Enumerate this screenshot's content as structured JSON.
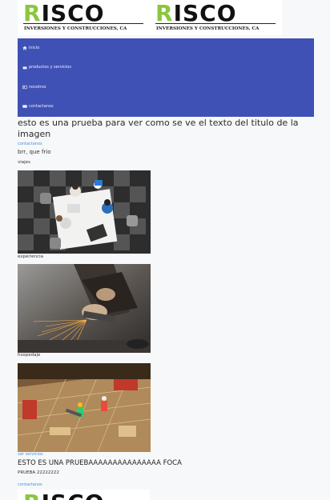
{
  "header": {
    "logo_text_r": "R",
    "logo_text_rest": "ISCO",
    "logo_tagline": "INVERSIONES Y CONSTRUCCIONES, CA"
  },
  "nav": {
    "items": [
      {
        "label": "inicio",
        "icon": "home-icon"
      },
      {
        "label": "productos y servicios",
        "icon": "calendar-icon"
      },
      {
        "label": "nosotros",
        "icon": "card-icon"
      },
      {
        "label": "contactanos",
        "icon": "mail-icon"
      }
    ]
  },
  "main": {
    "title": "esto es una prueba para ver como se ve el texto del titulo de la imagen",
    "contact_link": "contactanos",
    "subtitle": "brr, que frio",
    "sections": [
      {
        "label": "viajes",
        "image": "meeting-photo"
      },
      {
        "label": "experiencia",
        "image": "grinding-photo"
      },
      {
        "label": "hospedaje",
        "image": "construction-photo"
      }
    ],
    "services_link": "ver servicios",
    "heading2": "ESTO ES UNA PRUEBAAAAAAAAAAAAAAA FOCA",
    "heading2_sub": "PRUEBA 22222222",
    "contact_link2": "contactanos"
  }
}
